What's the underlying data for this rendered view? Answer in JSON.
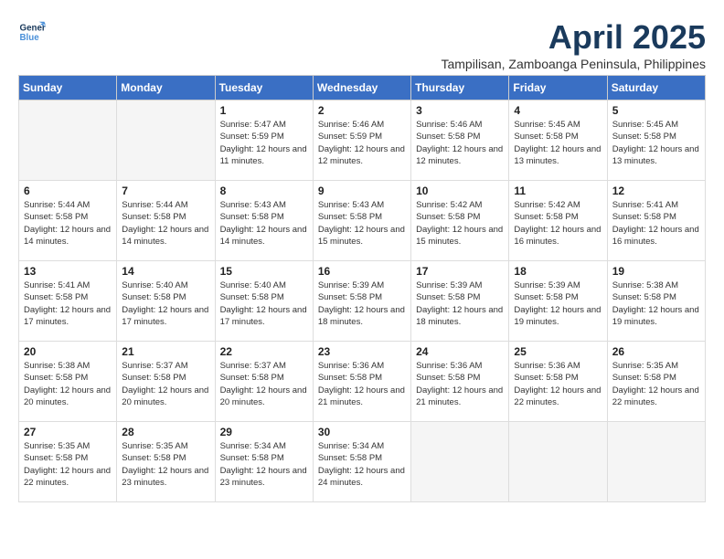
{
  "logo": {
    "line1": "General",
    "line2": "Blue"
  },
  "title": "April 2025",
  "subtitle": "Tampilisan, Zamboanga Peninsula, Philippines",
  "days_of_week": [
    "Sunday",
    "Monday",
    "Tuesday",
    "Wednesday",
    "Thursday",
    "Friday",
    "Saturday"
  ],
  "weeks": [
    [
      {
        "day": "",
        "info": ""
      },
      {
        "day": "",
        "info": ""
      },
      {
        "day": "1",
        "info": "Sunrise: 5:47 AM\nSunset: 5:59 PM\nDaylight: 12 hours and 11 minutes."
      },
      {
        "day": "2",
        "info": "Sunrise: 5:46 AM\nSunset: 5:59 PM\nDaylight: 12 hours and 12 minutes."
      },
      {
        "day": "3",
        "info": "Sunrise: 5:46 AM\nSunset: 5:58 PM\nDaylight: 12 hours and 12 minutes."
      },
      {
        "day": "4",
        "info": "Sunrise: 5:45 AM\nSunset: 5:58 PM\nDaylight: 12 hours and 13 minutes."
      },
      {
        "day": "5",
        "info": "Sunrise: 5:45 AM\nSunset: 5:58 PM\nDaylight: 12 hours and 13 minutes."
      }
    ],
    [
      {
        "day": "6",
        "info": "Sunrise: 5:44 AM\nSunset: 5:58 PM\nDaylight: 12 hours and 14 minutes."
      },
      {
        "day": "7",
        "info": "Sunrise: 5:44 AM\nSunset: 5:58 PM\nDaylight: 12 hours and 14 minutes."
      },
      {
        "day": "8",
        "info": "Sunrise: 5:43 AM\nSunset: 5:58 PM\nDaylight: 12 hours and 14 minutes."
      },
      {
        "day": "9",
        "info": "Sunrise: 5:43 AM\nSunset: 5:58 PM\nDaylight: 12 hours and 15 minutes."
      },
      {
        "day": "10",
        "info": "Sunrise: 5:42 AM\nSunset: 5:58 PM\nDaylight: 12 hours and 15 minutes."
      },
      {
        "day": "11",
        "info": "Sunrise: 5:42 AM\nSunset: 5:58 PM\nDaylight: 12 hours and 16 minutes."
      },
      {
        "day": "12",
        "info": "Sunrise: 5:41 AM\nSunset: 5:58 PM\nDaylight: 12 hours and 16 minutes."
      }
    ],
    [
      {
        "day": "13",
        "info": "Sunrise: 5:41 AM\nSunset: 5:58 PM\nDaylight: 12 hours and 17 minutes."
      },
      {
        "day": "14",
        "info": "Sunrise: 5:40 AM\nSunset: 5:58 PM\nDaylight: 12 hours and 17 minutes."
      },
      {
        "day": "15",
        "info": "Sunrise: 5:40 AM\nSunset: 5:58 PM\nDaylight: 12 hours and 17 minutes."
      },
      {
        "day": "16",
        "info": "Sunrise: 5:39 AM\nSunset: 5:58 PM\nDaylight: 12 hours and 18 minutes."
      },
      {
        "day": "17",
        "info": "Sunrise: 5:39 AM\nSunset: 5:58 PM\nDaylight: 12 hours and 18 minutes."
      },
      {
        "day": "18",
        "info": "Sunrise: 5:39 AM\nSunset: 5:58 PM\nDaylight: 12 hours and 19 minutes."
      },
      {
        "day": "19",
        "info": "Sunrise: 5:38 AM\nSunset: 5:58 PM\nDaylight: 12 hours and 19 minutes."
      }
    ],
    [
      {
        "day": "20",
        "info": "Sunrise: 5:38 AM\nSunset: 5:58 PM\nDaylight: 12 hours and 20 minutes."
      },
      {
        "day": "21",
        "info": "Sunrise: 5:37 AM\nSunset: 5:58 PM\nDaylight: 12 hours and 20 minutes."
      },
      {
        "day": "22",
        "info": "Sunrise: 5:37 AM\nSunset: 5:58 PM\nDaylight: 12 hours and 20 minutes."
      },
      {
        "day": "23",
        "info": "Sunrise: 5:36 AM\nSunset: 5:58 PM\nDaylight: 12 hours and 21 minutes."
      },
      {
        "day": "24",
        "info": "Sunrise: 5:36 AM\nSunset: 5:58 PM\nDaylight: 12 hours and 21 minutes."
      },
      {
        "day": "25",
        "info": "Sunrise: 5:36 AM\nSunset: 5:58 PM\nDaylight: 12 hours and 22 minutes."
      },
      {
        "day": "26",
        "info": "Sunrise: 5:35 AM\nSunset: 5:58 PM\nDaylight: 12 hours and 22 minutes."
      }
    ],
    [
      {
        "day": "27",
        "info": "Sunrise: 5:35 AM\nSunset: 5:58 PM\nDaylight: 12 hours and 22 minutes."
      },
      {
        "day": "28",
        "info": "Sunrise: 5:35 AM\nSunset: 5:58 PM\nDaylight: 12 hours and 23 minutes."
      },
      {
        "day": "29",
        "info": "Sunrise: 5:34 AM\nSunset: 5:58 PM\nDaylight: 12 hours and 23 minutes."
      },
      {
        "day": "30",
        "info": "Sunrise: 5:34 AM\nSunset: 5:58 PM\nDaylight: 12 hours and 24 minutes."
      },
      {
        "day": "",
        "info": ""
      },
      {
        "day": "",
        "info": ""
      },
      {
        "day": "",
        "info": ""
      }
    ]
  ]
}
